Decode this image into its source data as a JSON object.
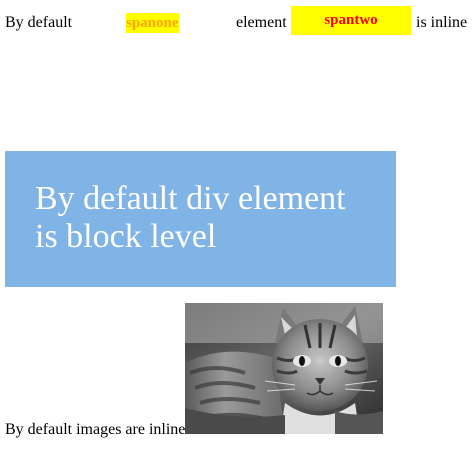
{
  "inline_row": {
    "text_before": "By default",
    "span_one": "spanone",
    "text_middle": "element",
    "span_two": "spantwo",
    "text_after": "is inline"
  },
  "block_div": {
    "line1": "By default div element",
    "line2": "is block level"
  },
  "image_row": {
    "caption": "By default images are inline",
    "image_icon": "cat-photo"
  },
  "colors": {
    "span_bg": "#ffff00",
    "span_one_text": "#ffa500",
    "span_two_text": "#ff0000",
    "block_bg": "#80b3e6",
    "block_text": "#ffffff"
  }
}
